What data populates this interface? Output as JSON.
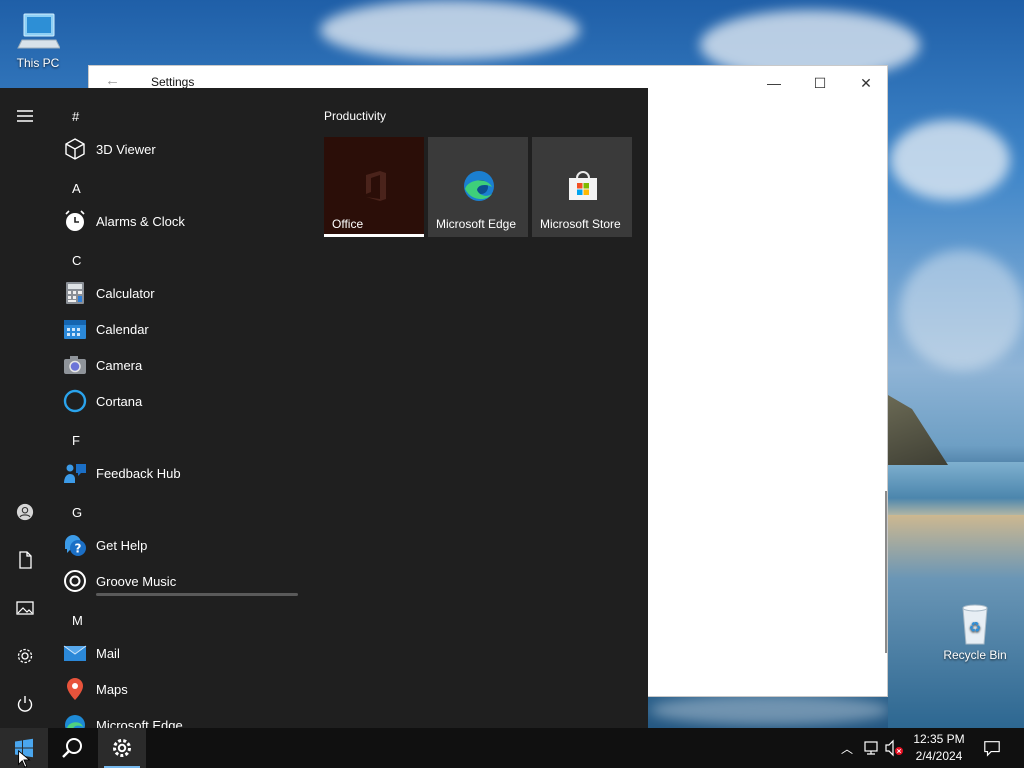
{
  "desktop": {
    "icons": [
      {
        "label": "This PC",
        "icon": "computer-icon"
      },
      {
        "label": "Recycle Bin",
        "icon": "recycle-bin-icon"
      }
    ]
  },
  "settings_window": {
    "title": "Settings",
    "controls": {
      "minimize": "—",
      "maximize": "☐",
      "close": "✕"
    }
  },
  "start_menu": {
    "rail": [
      "menu-icon",
      "user-icon",
      "documents-icon",
      "pictures-icon",
      "settings-icon",
      "power-icon"
    ],
    "groups": [
      {
        "letter": "#",
        "apps": [
          "3D Viewer"
        ]
      },
      {
        "letter": "A",
        "apps": [
          "Alarms & Clock"
        ]
      },
      {
        "letter": "C",
        "apps": [
          "Calculator",
          "Calendar",
          "Camera",
          "Cortana"
        ]
      },
      {
        "letter": "F",
        "apps": [
          "Feedback Hub"
        ]
      },
      {
        "letter": "G",
        "apps": [
          "Get Help",
          "Groove Music"
        ]
      },
      {
        "letter": "M",
        "apps": [
          "Mail",
          "Maps",
          "Microsoft Edge"
        ]
      }
    ],
    "tiles_header": "Productivity",
    "tiles": [
      {
        "label": "Office",
        "icon": "office-icon",
        "color": "#2b0e08"
      },
      {
        "label": "Microsoft Edge",
        "icon": "edge-icon",
        "color": "#3a3a3a"
      },
      {
        "label": "Microsoft Store",
        "icon": "store-icon",
        "color": "#3a3a3a"
      }
    ]
  },
  "taskbar": {
    "time": "12:35 PM",
    "date": "2/4/2024",
    "accent": "#77b9ee"
  }
}
